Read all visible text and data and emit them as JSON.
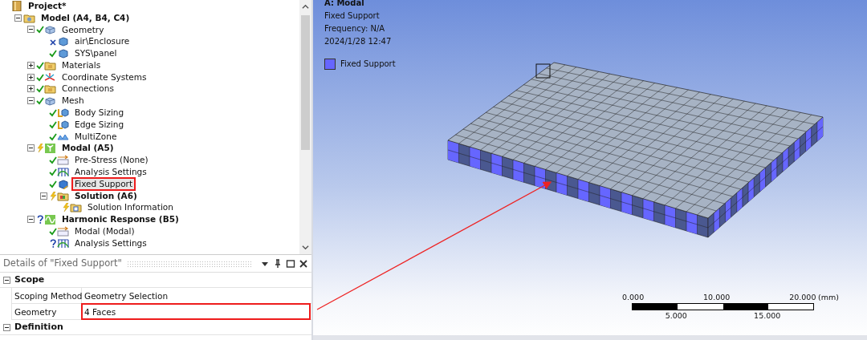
{
  "tree": {
    "label": "Project*",
    "kind": "project",
    "bold": true,
    "children": [
      {
        "label": "Model (A4, B4, C4)",
        "kind": "model",
        "bold": true,
        "expanded": true,
        "children": [
          {
            "label": "Geometry",
            "kind": "geometry",
            "status": {
              "kind": "ok"
            },
            "expanded": true,
            "children": [
              {
                "label": "air\\Enclosure",
                "kind": "body",
                "status": {
                  "kind": "cross"
                }
              },
              {
                "label": "SYS\\panel",
                "kind": "body",
                "status": {
                  "kind": "ok"
                }
              }
            ]
          },
          {
            "label": "Materials",
            "kind": "folder",
            "status": {
              "kind": "ok"
            },
            "expanded": false
          },
          {
            "label": "Coordinate Systems",
            "kind": "coordinates",
            "status": {
              "kind": "ok"
            },
            "expanded": false
          },
          {
            "label": "Connections",
            "kind": "folder",
            "status": {
              "kind": "ok"
            },
            "expanded": false
          },
          {
            "label": "Mesh",
            "kind": "geometry",
            "status": {
              "kind": "ok"
            },
            "expanded": true,
            "children": [
              {
                "label": "Body Sizing",
                "kind": "sizing",
                "status": {
                  "kind": "ok"
                }
              },
              {
                "label": "Edge Sizing",
                "kind": "sizing",
                "status": {
                  "kind": "ok"
                }
              },
              {
                "label": "MultiZone",
                "kind": "multizone",
                "status": {
                  "kind": "ok"
                }
              }
            ]
          },
          {
            "label": "Modal (A5)",
            "kind": "analysis",
            "bold": true,
            "status": {
              "kind": "lightning"
            },
            "expanded": true,
            "children": [
              {
                "label": "Pre-Stress (None)",
                "kind": "prestress",
                "status": {
                  "kind": "ok"
                }
              },
              {
                "label": "Analysis Settings",
                "kind": "settings",
                "status": {
                  "kind": "ok"
                }
              },
              {
                "label": "Fixed Support",
                "kind": "support",
                "status": {
                  "kind": "ok"
                },
                "selected": true,
                "annotated": true
              },
              {
                "label": "Solution (A6)",
                "kind": "solution",
                "bold": true,
                "status": {
                  "kind": "lightning"
                },
                "expanded": true,
                "children": [
                  {
                    "label": "Solution Information",
                    "kind": "info",
                    "status": {
                      "kind": "lightning"
                    }
                  }
                ]
              }
            ]
          },
          {
            "label": "Harmonic Response (B5)",
            "kind": "harmonic",
            "bold": true,
            "status": {
              "kind": "question"
            },
            "expanded": true,
            "children": [
              {
                "label": "Modal (Modal)",
                "kind": "prestress",
                "status": {
                  "kind": "ok"
                }
              },
              {
                "label": "Analysis Settings",
                "kind": "settings",
                "status": {
                  "kind": "question"
                }
              }
            ]
          }
        ]
      }
    ]
  },
  "details": {
    "title": "Details of \"Fixed Support\"",
    "groups": [
      {
        "label": "Scope",
        "expanded": true,
        "rows": [
          {
            "name": "Scoping Method",
            "value": "Geometry Selection",
            "annotated": false
          },
          {
            "name": "Geometry",
            "value": "4 Faces",
            "annotated": true
          }
        ]
      },
      {
        "label": "Definition",
        "expanded": true
      }
    ]
  },
  "viewport": {
    "title": "A: Modal",
    "lines": [
      "Fixed Support",
      "Frequency: N/A",
      "2024/1/28 12:47"
    ],
    "legend": [
      {
        "label": "Fixed Support",
        "color": "#6666ff"
      }
    ],
    "scale": {
      "top_labels": [
        "0.000",
        "10.000",
        "20.000"
      ],
      "unit": "(mm)",
      "bottom_labels": [
        "5.000",
        "15.000"
      ]
    }
  }
}
